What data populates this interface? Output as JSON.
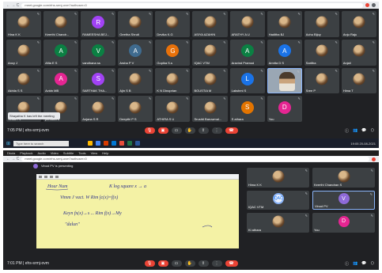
{
  "colors": {
    "meet_bg": "#202124",
    "tile_bg": "#3c4043",
    "end_call": "#ea4335",
    "accent_blue": "#8ab4f8",
    "whiteboard": "#f4f2a5"
  },
  "shot1": {
    "browser": {
      "url": "meet.google.com/ehs-srmj-ovm?authuser=0",
      "nav": "← → C"
    },
    "participants": [
      {
        "name": "Hina K K",
        "type": "photo"
      },
      {
        "name": "Keerthi Chandr...",
        "type": "photo"
      },
      {
        "name": "RAMEESHA BEJ...",
        "type": "letter",
        "letter": "R",
        "color": "#a142f4"
      },
      {
        "name": "Geetha Shruti",
        "type": "photo"
      },
      {
        "name": "Devika K.G",
        "type": "photo"
      },
      {
        "name": "ASIYA AZAHIN",
        "type": "photo"
      },
      {
        "name": "ARATHY A U",
        "type": "photo"
      },
      {
        "name": "Haditha BJ",
        "type": "photo"
      },
      {
        "name": "Achu Bijoy",
        "type": "photo"
      },
      {
        "name": "Anju Raju",
        "type": "photo"
      },
      {
        "name": "Ancy J",
        "type": "photo"
      },
      {
        "name": "Afila E S",
        "type": "letter",
        "letter": "A",
        "color": "#0b8043"
      },
      {
        "name": "vandhana ss",
        "type": "letter",
        "letter": "V",
        "color": "#0b8043"
      },
      {
        "name": "Arsha P V",
        "type": "letter",
        "letter": "A",
        "color": "#3f6b8f"
      },
      {
        "name": "Gopika S.s",
        "type": "letter",
        "letter": "G",
        "color": "#e8710a"
      },
      {
        "name": "IQAC VTM",
        "type": "photo"
      },
      {
        "name": "Aravind Pramod",
        "type": "letter",
        "letter": "A",
        "color": "#0b8043"
      },
      {
        "name": "Amrita D S",
        "type": "letter",
        "letter": "A",
        "color": "#1a73e8"
      },
      {
        "name": "Saritha",
        "type": "photo"
      },
      {
        "name": "Anjali",
        "type": "photo"
      },
      {
        "name": "Akhila S S",
        "type": "photo"
      },
      {
        "name": "Avidn MB",
        "type": "letter",
        "letter": "A",
        "color": "#e52592"
      },
      {
        "name": "SARTHAK THA...",
        "type": "letter",
        "letter": "S",
        "color": "#a142f4"
      },
      {
        "name": "Ajin S B",
        "type": "photo"
      },
      {
        "name": "K N Dinoprian",
        "type": "photo"
      },
      {
        "name": "BOUSTIA M",
        "type": "photo"
      },
      {
        "name": "Lakshmi S",
        "type": "letter",
        "letter": "L",
        "color": "#1a73e8"
      },
      {
        "name": "",
        "type": "video"
      },
      {
        "name": "Sree P",
        "type": "photo"
      },
      {
        "name": "Hima T",
        "type": "photo"
      },
      {
        "name": "Vinod PV",
        "type": "photo"
      },
      {
        "name": "pernattu s",
        "type": "photo"
      },
      {
        "name": "Anjana S R",
        "type": "photo"
      },
      {
        "name": "Deepthi P S",
        "type": "photo"
      },
      {
        "name": "ATHIRA S U",
        "type": "photo"
      },
      {
        "name": "Srushti Baruwmal...",
        "type": "photo"
      },
      {
        "name": "S athara",
        "type": "letter",
        "letter": "S",
        "color": "#e37400"
      },
      {
        "name": "You",
        "type": "letter",
        "letter": "D",
        "color": "#e52592"
      }
    ],
    "toast": {
      "text": "Shayatha K has left the meeting"
    },
    "time": "7:05 PM | ehs-srmj-ovm",
    "taskbar": {
      "search": "Type here to search",
      "tray": "19:05\n20-08-2021"
    }
  },
  "shot2": {
    "menu": [
      "Dkola",
      "Playback",
      "Audio",
      "Video",
      "Subtitle",
      "Tools",
      "View",
      "Help"
    ],
    "browser": {
      "url": "meet.google.com/ehs-srmj-ovm?authuser=0"
    },
    "presenting": "Vinod PV is presenting",
    "notes": [
      "Hour Num",
      "K log square  x → a",
      "Vimm J vact.  W Rim  ∫c(x)=f(x)",
      "Keyn  fx(x)→s  ... Rim  f(x)→My",
      "\"dalun\""
    ],
    "side_tiles": [
      {
        "name": "Hima K K",
        "type": "photo"
      },
      {
        "name": "Keerthi Chandran S",
        "type": "photo"
      },
      {
        "name": "IQAC VTM",
        "type": "ring",
        "letter": "IQAC"
      },
      {
        "name": "Vinod PV",
        "type": "letter",
        "letter": "V",
        "color": "#8e6ad8",
        "active": true
      },
      {
        "name": "Ki athara",
        "type": "photo"
      },
      {
        "name": "You",
        "type": "letter",
        "letter": "D",
        "color": "#e52592"
      }
    ],
    "time": "7:01 PM | ehs-srmj-ovm"
  }
}
